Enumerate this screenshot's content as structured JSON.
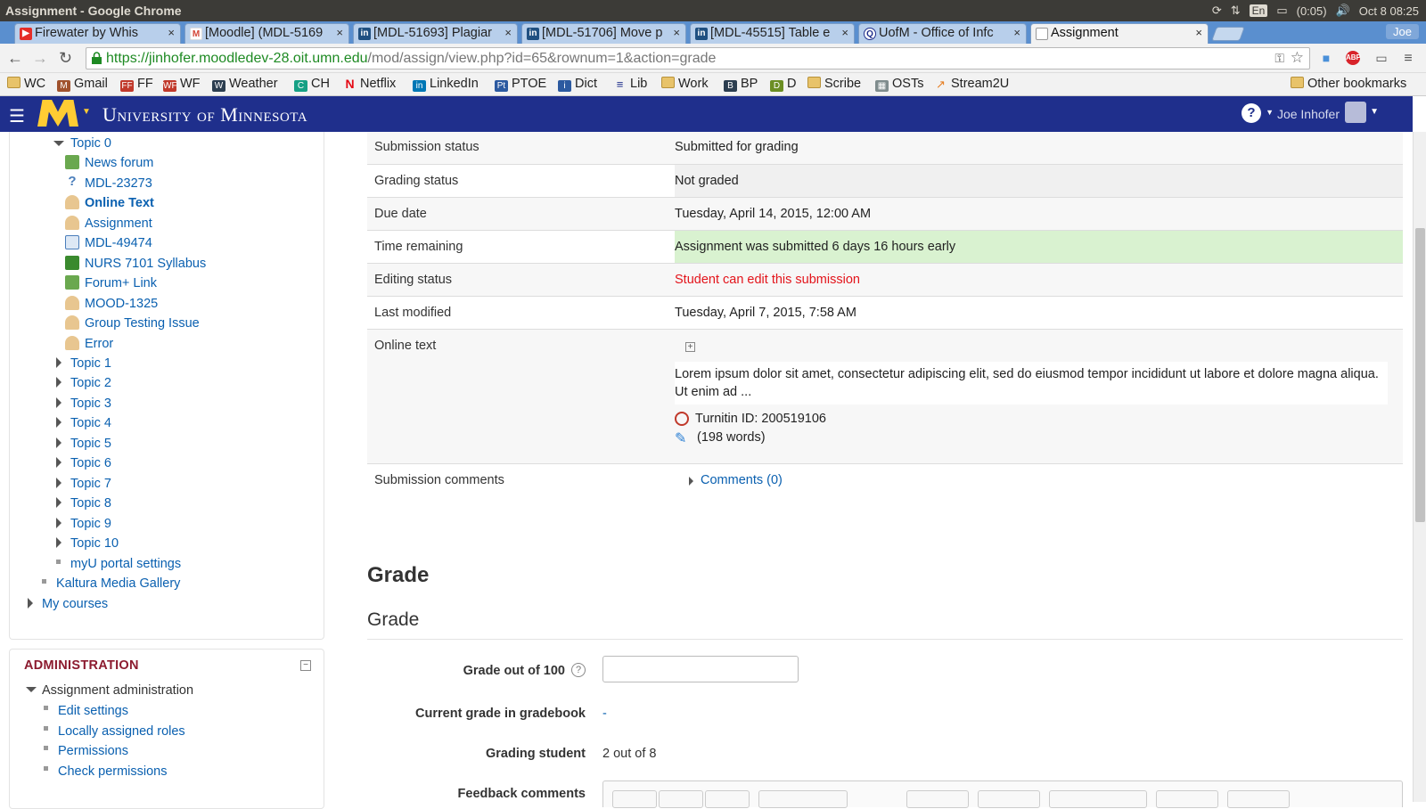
{
  "os": {
    "window_title": "Assignment - Google Chrome",
    "battery": "(0:05)",
    "input_lang": "En",
    "datetime": "Oct 8 08:25",
    "user_short": "Joe"
  },
  "tabs": [
    {
      "label": "Firewater by Whis",
      "favicon": "youtube"
    },
    {
      "label": "[Moodle] (MDL-5169",
      "favicon": "gmail"
    },
    {
      "label": "[MDL-51693] Plagiar",
      "favicon": "jira"
    },
    {
      "label": "[MDL-51706] Move p",
      "favicon": "jira"
    },
    {
      "label": "[MDL-45515] Table e",
      "favicon": "jira"
    },
    {
      "label": "UofM - Office of Infc",
      "favicon": "chat"
    },
    {
      "label": "Assignment",
      "favicon": "page",
      "active": true
    }
  ],
  "url": {
    "host": "https://jinhofer.moodledev-28.oit.umn.edu",
    "path": "/mod/assign/view.php?id=65&rownum=1&action=grade"
  },
  "bookmarks": [
    "WC",
    "Gmail",
    "FF",
    "WF",
    "Weather",
    "CH",
    "Netflix",
    "LinkedIn",
    "PTOE",
    "Dict",
    "Lib",
    "Work",
    "BP",
    "D",
    "Scribe",
    "OSTs",
    "Stream2U"
  ],
  "other_bookmarks": "Other bookmarks",
  "site": {
    "name": "University of Minnesota",
    "user": "Joe Inhofer"
  },
  "nav": {
    "topic0": "Topic 0",
    "activities": [
      "News forum",
      "MDL-23273",
      "Online Text",
      "Assignment",
      "MDL-49474",
      "NURS 7101 Syllabus",
      "Forum+ Link",
      "MOOD-1325",
      "Group Testing Issue",
      "Error"
    ],
    "topics": [
      "Topic 1",
      "Topic 2",
      "Topic 3",
      "Topic 4",
      "Topic 5",
      "Topic 6",
      "Topic 7",
      "Topic 8",
      "Topic 9",
      "Topic 10"
    ],
    "myu": "myU portal settings",
    "kaltura": "Kaltura Media Gallery",
    "my_courses": "My courses"
  },
  "admin": {
    "title": "ADMINISTRATION",
    "section": "Assignment administration",
    "items": [
      "Edit settings",
      "Locally assigned roles",
      "Permissions",
      "Check permissions"
    ]
  },
  "submission": {
    "rows": [
      {
        "label": "Submission status",
        "value": "Submitted for grading"
      },
      {
        "label": "Grading status",
        "value": "Not graded"
      },
      {
        "label": "Due date",
        "value": "Tuesday, April 14, 2015, 12:00 AM"
      },
      {
        "label": "Time remaining",
        "value": "Assignment was submitted 6 days 16 hours early"
      },
      {
        "label": "Editing status",
        "value": "Student can edit this submission"
      },
      {
        "label": "Last modified",
        "value": "Tuesday, April 7, 2015, 7:58 AM"
      },
      {
        "label": "Online text",
        "value": ""
      },
      {
        "label": "Submission comments",
        "value": ""
      }
    ],
    "online_text": "Lorem ipsum dolor sit amet, consectetur adipiscing elit, sed do eiusmod tempor incididunt ut labore et dolore magna aliqua. Ut enim ad ...",
    "turnitin": "Turnitin ID: 200519106",
    "words": "(198 words)",
    "comments_link": "Comments (0)",
    "colors": {
      "success_bg": "#d9f2d0",
      "error_text": "#e3141b"
    }
  },
  "grade": {
    "heading": "Grade",
    "subheading": "Grade",
    "grade_out_of_label": "Grade out of 100",
    "grade_value": "",
    "current_grade_label": "Current grade in gradebook",
    "current_grade_value": "-",
    "grading_student_label": "Grading student",
    "grading_student_value": "2 out of 8",
    "feedback_label": "Feedback comments"
  }
}
